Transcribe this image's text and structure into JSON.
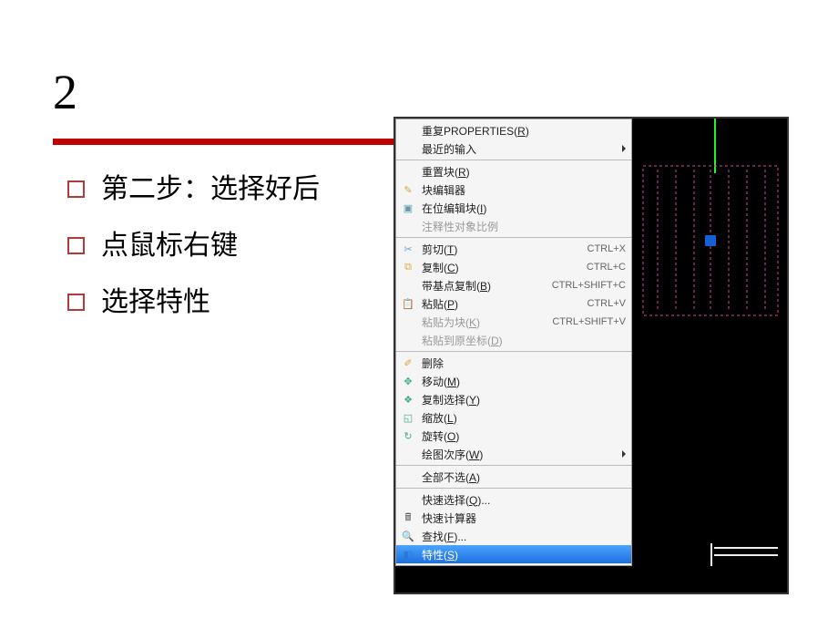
{
  "title": "2",
  "bullets": [
    "第二步：选择好后",
    "点鼠标右键",
    "选择特性"
  ],
  "menu": {
    "group1": [
      {
        "label_pre": "重复PROPERTIES(",
        "label_u": "R",
        "label_post": ")"
      },
      {
        "label_pre": "最近的输入",
        "label_u": "",
        "label_post": "",
        "arrow": true
      }
    ],
    "group2": [
      {
        "label_pre": "重置块(",
        "label_u": "R",
        "label_post": ")"
      },
      {
        "label_pre": "块编辑器",
        "label_u": "",
        "label_post": ""
      },
      {
        "label_pre": "在位编辑块(",
        "label_u": "I",
        "label_post": ")"
      },
      {
        "label_pre": "注释性对象比例",
        "label_u": "",
        "label_post": "",
        "disabled": true
      }
    ],
    "group3": [
      {
        "label_pre": "剪切(",
        "label_u": "T",
        "label_post": ")",
        "shortcut": "CTRL+X"
      },
      {
        "label_pre": "复制(",
        "label_u": "C",
        "label_post": ")",
        "shortcut": "CTRL+C"
      },
      {
        "label_pre": "带基点复制(",
        "label_u": "B",
        "label_post": ")",
        "shortcut": "CTRL+SHIFT+C"
      },
      {
        "label_pre": "粘贴(",
        "label_u": "P",
        "label_post": ")",
        "shortcut": "CTRL+V"
      },
      {
        "label_pre": "粘贴为块(",
        "label_u": "K",
        "label_post": ")",
        "shortcut": "CTRL+SHIFT+V",
        "disabled": true
      },
      {
        "label_pre": "粘贴到原坐标(",
        "label_u": "D",
        "label_post": ")",
        "disabled": true
      }
    ],
    "group4": [
      {
        "label_pre": "删除",
        "label_u": "",
        "label_post": ""
      },
      {
        "label_pre": "移动(",
        "label_u": "M",
        "label_post": ")"
      },
      {
        "label_pre": "复制选择(",
        "label_u": "Y",
        "label_post": ")"
      },
      {
        "label_pre": "缩放(",
        "label_u": "L",
        "label_post": ")"
      },
      {
        "label_pre": "旋转(",
        "label_u": "O",
        "label_post": ")"
      },
      {
        "label_pre": "绘图次序(",
        "label_u": "W",
        "label_post": ")",
        "arrow": true
      }
    ],
    "group5": [
      {
        "label_pre": "全部不选(",
        "label_u": "A",
        "label_post": ")"
      }
    ],
    "group6": [
      {
        "label_pre": "快速选择(",
        "label_u": "Q",
        "label_post": ")..."
      },
      {
        "label_pre": "快速计算器",
        "label_u": "",
        "label_post": ""
      },
      {
        "label_pre": "查找(",
        "label_u": "F",
        "label_post": ")..."
      },
      {
        "label_pre": "特性(",
        "label_u": "S",
        "label_post": ")",
        "selected": true
      }
    ]
  }
}
